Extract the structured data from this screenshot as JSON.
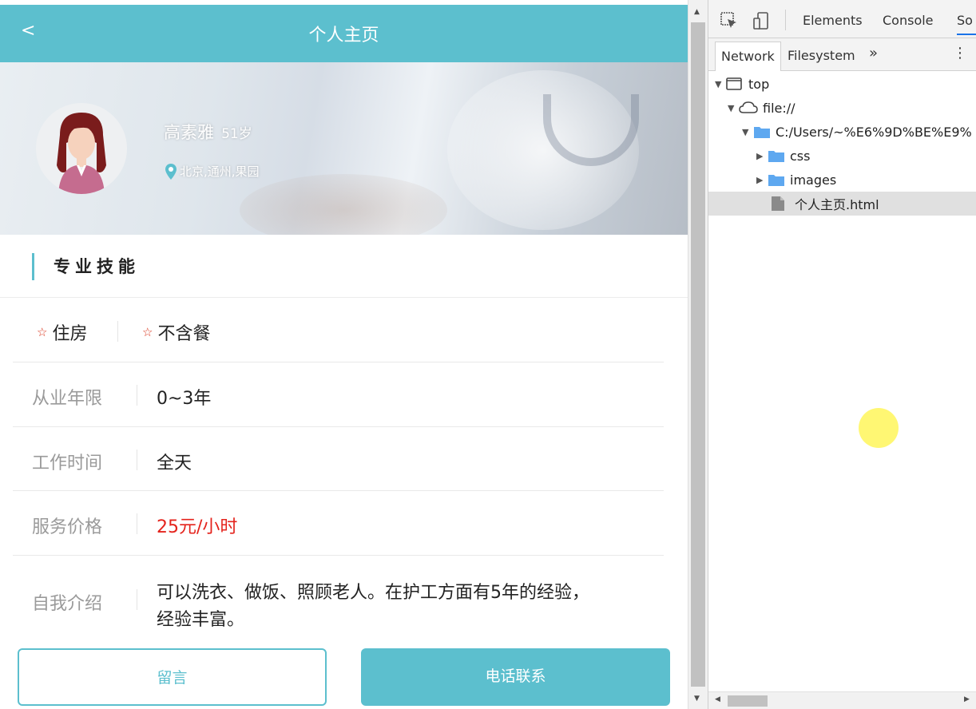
{
  "header": {
    "back_label": "<",
    "title": "个人主页"
  },
  "profile": {
    "name": "高素雅",
    "age": "51岁",
    "location": "北京,通州,果园"
  },
  "skills": {
    "heading": "专业技能",
    "tags": [
      "住房",
      "不含餐"
    ],
    "rows": [
      {
        "label": "从业年限",
        "value": "0~3年"
      },
      {
        "label": "工作时间",
        "value": "全天"
      },
      {
        "label": "服务价格",
        "value": "25元/小时"
      },
      {
        "label": "自我介绍",
        "value_line1": "可以洗衣、做饭、照顾老人。在护工方面有5年的经验，",
        "value_line2": "经验丰富。"
      }
    ]
  },
  "buttons": {
    "message": "留言",
    "call": "电话联系"
  },
  "colors": {
    "accent": "#5cbfce",
    "price": "#e4231c",
    "star": "#d9331a"
  },
  "devtools": {
    "tabs": [
      "Elements",
      "Console",
      "So"
    ],
    "subtabs": [
      "Network",
      "Filesystem"
    ],
    "more": "»",
    "menu": "⋮",
    "tree": {
      "top": "top",
      "origin": "file://",
      "folder": "C:/Users/~%E6%9D%BE%E9%",
      "css": "css",
      "images": "images",
      "file": "个人主页.html"
    },
    "icons": [
      "inspect-icon",
      "device-toolbar-icon",
      "frame-icon",
      "cloud-icon",
      "folder-icon",
      "file-icon"
    ]
  }
}
